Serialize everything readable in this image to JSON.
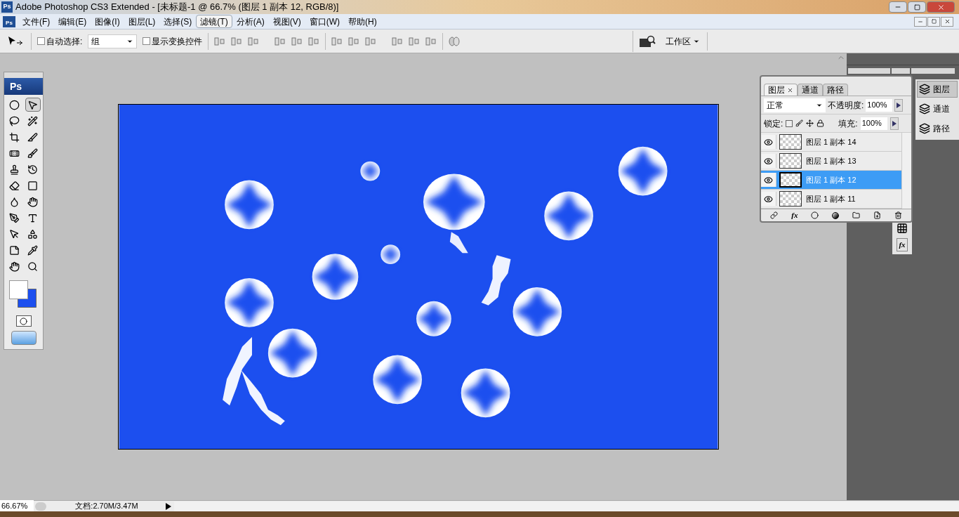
{
  "window": {
    "app_icon": "Ps",
    "title": "Adobe Photoshop CS3 Extended - [未标题-1 @ 66.7% (图层 1 副本 12, RGB/8)]",
    "doc_icon": "Ps"
  },
  "menu": [
    {
      "label": "文件(F)",
      "selected": false
    },
    {
      "label": "编辑(E)",
      "selected": false
    },
    {
      "label": "图像(I)",
      "selected": false
    },
    {
      "label": "图层(L)",
      "selected": false
    },
    {
      "label": "选择(S)",
      "selected": false
    },
    {
      "label": "滤镜(T)",
      "selected": true
    },
    {
      "label": "分析(A)",
      "selected": false
    },
    {
      "label": "视图(V)",
      "selected": false
    },
    {
      "label": "窗口(W)",
      "selected": false
    },
    {
      "label": "帮助(H)",
      "selected": false
    }
  ],
  "options_bar": {
    "auto_select": {
      "label": "自动选择:",
      "checked": false
    },
    "auto_select_target": "组",
    "show_transform": {
      "label": "显示变换控件",
      "checked": false
    },
    "workspace": "工作区"
  },
  "toolbox": {
    "logo": "Ps",
    "tools": [
      {
        "kind": "marquee",
        "selected": false
      },
      {
        "kind": "move",
        "selected": true
      },
      {
        "kind": "lasso",
        "selected": false
      },
      {
        "kind": "wand",
        "selected": false
      },
      {
        "kind": "crop",
        "selected": false
      },
      {
        "kind": "slice",
        "selected": false
      },
      {
        "kind": "heal",
        "selected": false
      },
      {
        "kind": "brush",
        "selected": false
      },
      {
        "kind": "stamp",
        "selected": false
      },
      {
        "kind": "history",
        "selected": false
      },
      {
        "kind": "eraser",
        "selected": false
      },
      {
        "kind": "gradient",
        "selected": false
      },
      {
        "kind": "blur",
        "selected": false
      },
      {
        "kind": "dodge",
        "selected": false
      },
      {
        "kind": "pen",
        "selected": false
      },
      {
        "kind": "type",
        "selected": false
      },
      {
        "kind": "select",
        "selected": false
      },
      {
        "kind": "shape",
        "selected": false
      },
      {
        "kind": "notes",
        "selected": false
      },
      {
        "kind": "eyedropper",
        "selected": false
      },
      {
        "kind": "hand",
        "selected": false
      },
      {
        "kind": "zoom",
        "selected": false
      }
    ]
  },
  "layers_panel": {
    "tabs": [
      {
        "label": "图层",
        "selected": true
      },
      {
        "label": "通道",
        "selected": false
      },
      {
        "label": "路径",
        "selected": false
      }
    ],
    "blend_mode": "正常",
    "opacity_label": "不透明度:",
    "opacity": "100%",
    "lock_label": "锁定:",
    "fill_label": "填充:",
    "fill": "100%",
    "layers": [
      {
        "name": "图层 1 副本 14",
        "visible": true,
        "selected": false
      },
      {
        "name": "图层 1 副本 13",
        "visible": true,
        "selected": false
      },
      {
        "name": "图层 1 副本 12",
        "visible": true,
        "selected": true
      },
      {
        "name": "图层 1 副本 11",
        "visible": true,
        "selected": false
      }
    ],
    "fx_button": "fx"
  },
  "dock": {
    "items": [
      {
        "label": "图层",
        "selected": true
      },
      {
        "label": "通道",
        "selected": false
      },
      {
        "label": "路径",
        "selected": false
      }
    ],
    "fx_button": "fx"
  },
  "status_bar": {
    "zoom": "66.67%",
    "doc_info": "文档:2.70M/3.47M"
  }
}
